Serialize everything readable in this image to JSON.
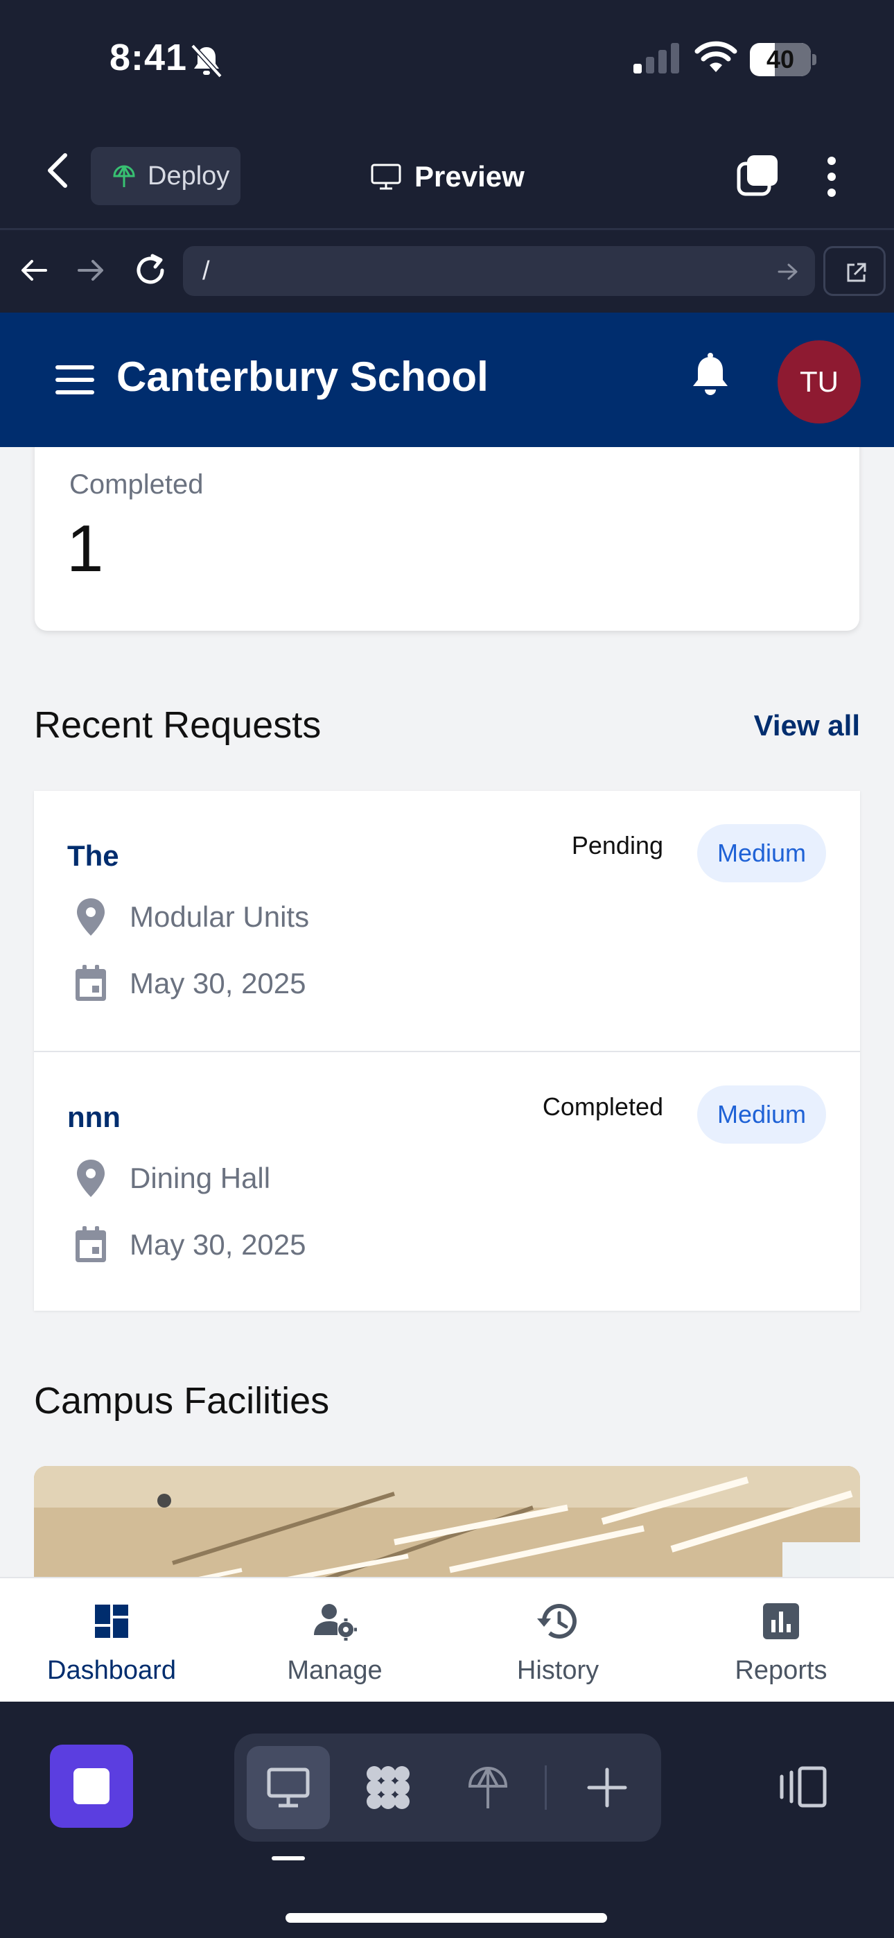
{
  "status_bar": {
    "time": "8:41",
    "battery": "40"
  },
  "editor": {
    "deploy_label": "Deploy",
    "preview_label": "Preview"
  },
  "browser": {
    "url": "/"
  },
  "app": {
    "title": "Canterbury School",
    "avatar_initials": "TU",
    "colors": {
      "primary": "#002d6e",
      "avatar": "#8e1a31",
      "badge_bg": "#e8f0fe",
      "badge_text": "#1f62d6"
    }
  },
  "stat_card": {
    "label": "Completed",
    "value": "1"
  },
  "recent_requests": {
    "title": "Recent Requests",
    "view_all": "View all",
    "items": [
      {
        "title": "The",
        "status": "Pending",
        "priority": "Medium",
        "location": "Modular Units",
        "date": "May 30, 2025"
      },
      {
        "title": "nnn",
        "status": "Completed",
        "priority": "Medium",
        "location": "Dining Hall",
        "date": "May 30, 2025"
      }
    ]
  },
  "facilities": {
    "title": "Campus Facilities"
  },
  "tab_bar": {
    "items": [
      {
        "label": "Dashboard",
        "icon": "dashboard-icon",
        "active": true
      },
      {
        "label": "Manage",
        "icon": "manage-users-icon",
        "active": false
      },
      {
        "label": "History",
        "icon": "history-icon",
        "active": false
      },
      {
        "label": "Reports",
        "icon": "reports-icon",
        "active": false
      }
    ]
  },
  "dock": {
    "icons": [
      "stop-icon",
      "monitor-icon",
      "apps-icon",
      "deploy-icon",
      "add-icon",
      "devices-icon"
    ]
  }
}
